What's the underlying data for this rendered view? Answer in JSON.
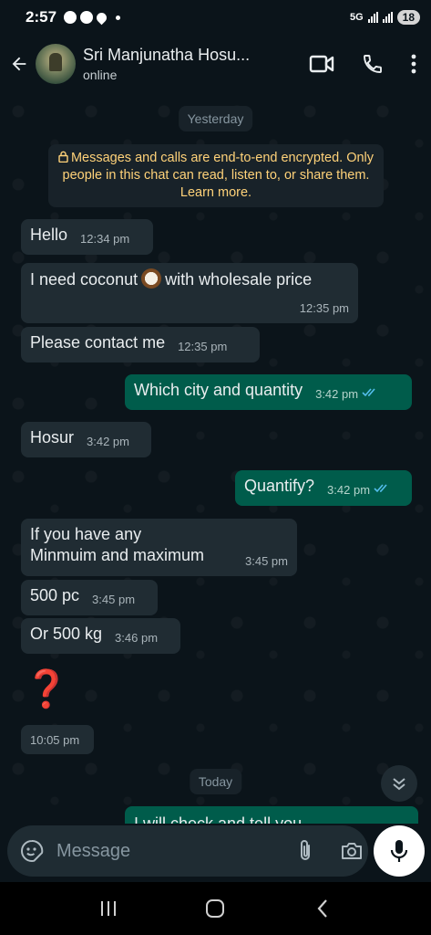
{
  "status_bar": {
    "time": "2:57",
    "network_label": "5G",
    "battery": "18"
  },
  "header": {
    "contact_name": "Sri Manjunatha Hosu...",
    "contact_status": "online",
    "icons": [
      "back-arrow-icon",
      "video-call-icon",
      "phone-icon",
      "more-vert-icon"
    ]
  },
  "chat": {
    "date_yesterday": "Yesterday",
    "encryption_notice": "Messages and calls are end-to-end encrypted. Only people in this chat can read, listen to, or share them. Learn more.",
    "date_today": "Today",
    "messages": [
      {
        "dir": "in",
        "text": "Hello",
        "time": "12:34 pm"
      },
      {
        "dir": "in",
        "text_before": "I need coconut",
        "text_after": "with wholesale price",
        "time": "12:35 pm"
      },
      {
        "dir": "in",
        "text": "Please contact me",
        "time": "12:35 pm"
      },
      {
        "dir": "out",
        "text": "Which city and quantity",
        "time": "3:42 pm"
      },
      {
        "dir": "in",
        "text": "Hosur",
        "time": "3:42 pm"
      },
      {
        "dir": "out",
        "text": "Quantify?",
        "time": "3:42 pm"
      },
      {
        "dir": "in",
        "line1": "If you have any",
        "line2": "Minmuim and maximum",
        "time": "3:45 pm"
      },
      {
        "dir": "in",
        "text": "500 pc",
        "time": "3:45 pm"
      },
      {
        "dir": "in",
        "text": "Or 500 kg",
        "time": "3:46 pm"
      },
      {
        "dir": "in",
        "text": "❓",
        "time": "10:05 pm"
      }
    ],
    "partial_message": "I will check and tell you"
  },
  "composer": {
    "placeholder": "Message",
    "icons": [
      "sticker-icon",
      "attach-icon",
      "camera-icon",
      "mic-icon"
    ]
  },
  "colors": {
    "background": "#0b141a",
    "incoming_bubble": "#202c33",
    "outgoing_bubble": "#005c4b",
    "read_ticks": "#53bdeb",
    "encryption_text": "#ffd279"
  }
}
